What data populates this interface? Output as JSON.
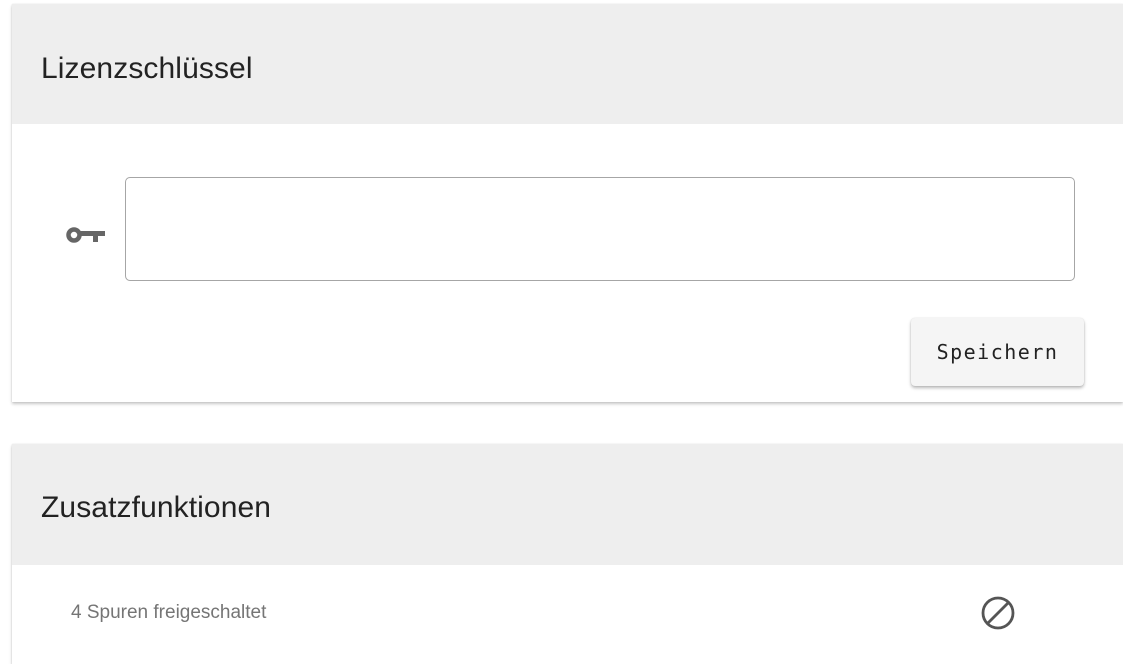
{
  "license": {
    "title": "Lizenzschlüssel",
    "input_value": "",
    "input_placeholder": "",
    "icon": "key-icon",
    "save_label": "Speichern"
  },
  "features": {
    "title": "Zusatzfunktionen",
    "items": [
      {
        "label": "4 Spuren freigeschaltet",
        "status_icon": "blocked-icon",
        "status": "disabled"
      }
    ]
  },
  "colors": {
    "header_background": "#eeeeee",
    "card_background": "#ffffff",
    "icon_color": "#666666",
    "label_muted": "#757575"
  }
}
